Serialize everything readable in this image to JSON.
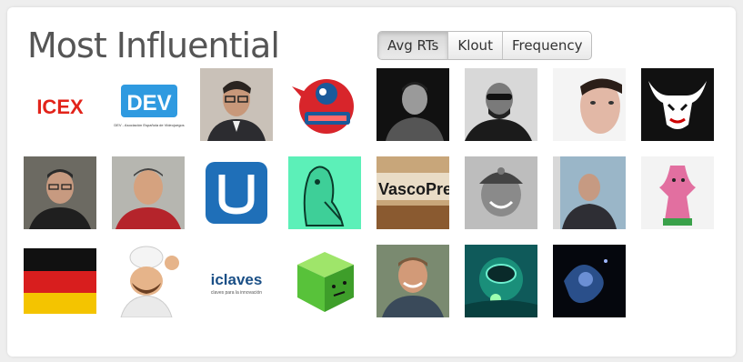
{
  "widget": {
    "title": "Most Influential",
    "tabs": [
      "Avg RTs",
      "Klout",
      "Frequency"
    ],
    "active_tab": "Avg RTs"
  },
  "logos": {
    "icex": "ICEX",
    "dev": "DEV",
    "dev_sub": "DEV - Asociación Española de Videojuegos",
    "vasco": "VascoPre",
    "iclaves": "iclaves",
    "iclaves_sub": "claves para la innovación"
  },
  "avatars": [
    {
      "name": "icex-logo"
    },
    {
      "name": "dev-logo"
    },
    {
      "name": "man-glasses-portrait"
    },
    {
      "name": "red-cartoon-badge"
    },
    {
      "name": "man-black-white-portrait"
    },
    {
      "name": "man-sunglasses-portrait"
    },
    {
      "name": "man-closeup-portrait"
    },
    {
      "name": "bull-logo"
    },
    {
      "name": "man-glasses-smiling"
    },
    {
      "name": "man-red-shirt"
    },
    {
      "name": "blue-u-logo"
    },
    {
      "name": "green-cartoon-figure"
    },
    {
      "name": "vasco-wood-sign"
    },
    {
      "name": "man-cap-bw"
    },
    {
      "name": "man-outdoors-suit"
    },
    {
      "name": "pink-cactus-figure"
    },
    {
      "name": "german-flag"
    },
    {
      "name": "swedish-chef-puppet"
    },
    {
      "name": "iclaves-logo"
    },
    {
      "name": "green-cube-character"
    },
    {
      "name": "man-smiling-outdoors"
    },
    {
      "name": "diver-underwater"
    },
    {
      "name": "dark-blue-abstract"
    }
  ]
}
